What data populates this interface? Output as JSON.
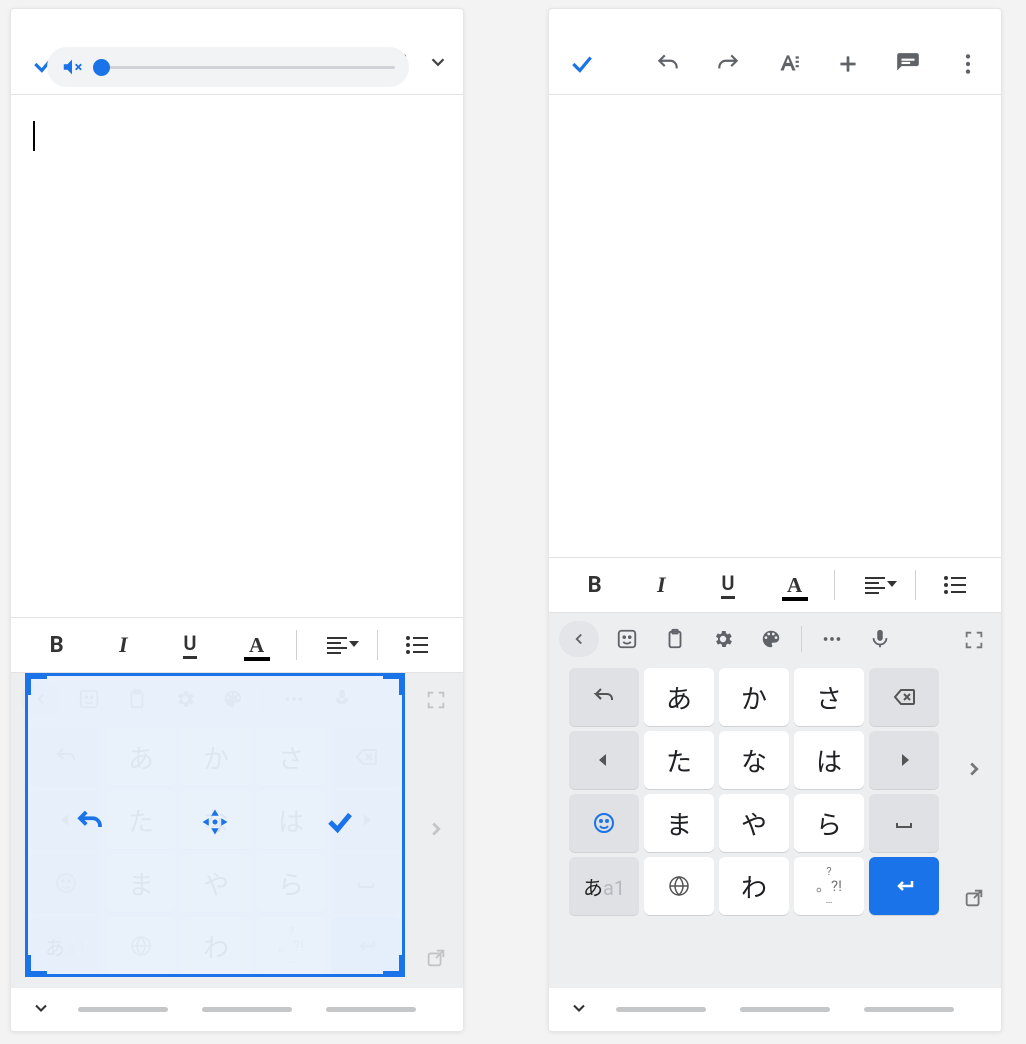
{
  "colors": {
    "accent": "#1a73e8"
  },
  "format_bar": {
    "bold": "B",
    "italic": "I",
    "underline": "U",
    "font_color": "A"
  },
  "keyboard": {
    "mode_label_jp": "あ",
    "mode_label_en": "a1",
    "rows": [
      [
        "あ",
        "か",
        "さ"
      ],
      [
        "た",
        "な",
        "は"
      ],
      [
        "ま",
        "や",
        "ら"
      ],
      [
        "",
        "わ",
        ""
      ]
    ],
    "symbol_key": {
      "top": "?",
      "mid": "。?!",
      "bottom": "…"
    }
  }
}
